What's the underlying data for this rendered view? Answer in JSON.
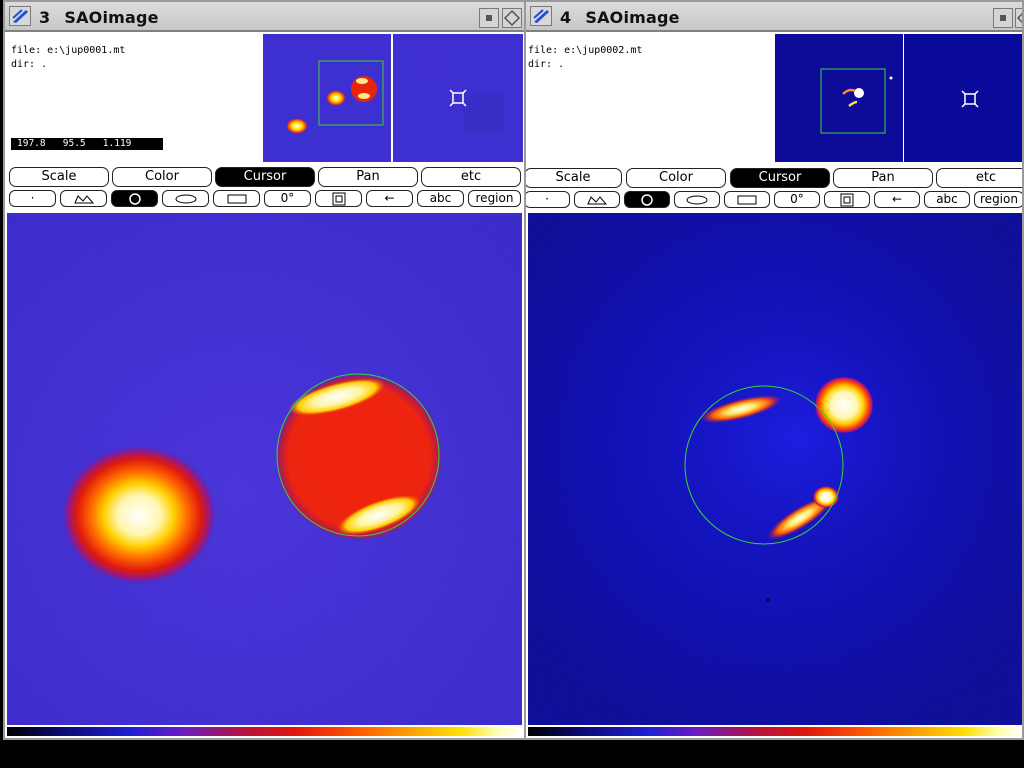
{
  "windows": [
    {
      "id": "left",
      "number": "3",
      "title": "SAOimage",
      "file_line": "file: e:\\jup0001.mt",
      "dir_line": "dir: .",
      "readout": "197.8   95.5   1.119",
      "buttons": [
        "Scale",
        "Color",
        "Cursor",
        "Pan",
        "etc"
      ],
      "active_button": "Cursor",
      "cursor_buttons": [
        "·",
        "",
        "",
        "",
        "",
        "0°",
        "",
        "←",
        "abc",
        "region"
      ]
    },
    {
      "id": "right",
      "number": "4",
      "title": "SAOimage",
      "file_line": "file: e:\\jup0002.mt",
      "dir_line": "dir: .",
      "buttons": [
        "Scale",
        "Color",
        "Cursor",
        "Pan",
        "etc"
      ],
      "active_button": "Cursor",
      "cursor_buttons": [
        "·",
        "",
        "",
        "",
        "",
        "0°",
        "",
        "←",
        "abc",
        "region"
      ]
    }
  ],
  "icons": {
    "window_menu": "window-menu-icon",
    "iconify": "iconify-icon",
    "maximize": "maximize-icon",
    "cursor_point": "point-cursor-icon",
    "cursor_polygon": "polygon-cursor-icon",
    "cursor_circle": "circle-cursor-icon",
    "cursor_ellipse": "ellipse-cursor-icon",
    "cursor_box": "box-cursor-icon",
    "cursor_annulus": "annulus-cursor-icon",
    "cursor_arrow": "arrow-cursor-icon"
  },
  "colors": {
    "frame": "#9a9a9a",
    "titlebar": "#c7c7c7",
    "image_bg_left": "#3d2fd0",
    "image_bg_right": "#0a0a9a",
    "cursor_circle": "#3cd23c",
    "active_button": "#000000"
  }
}
